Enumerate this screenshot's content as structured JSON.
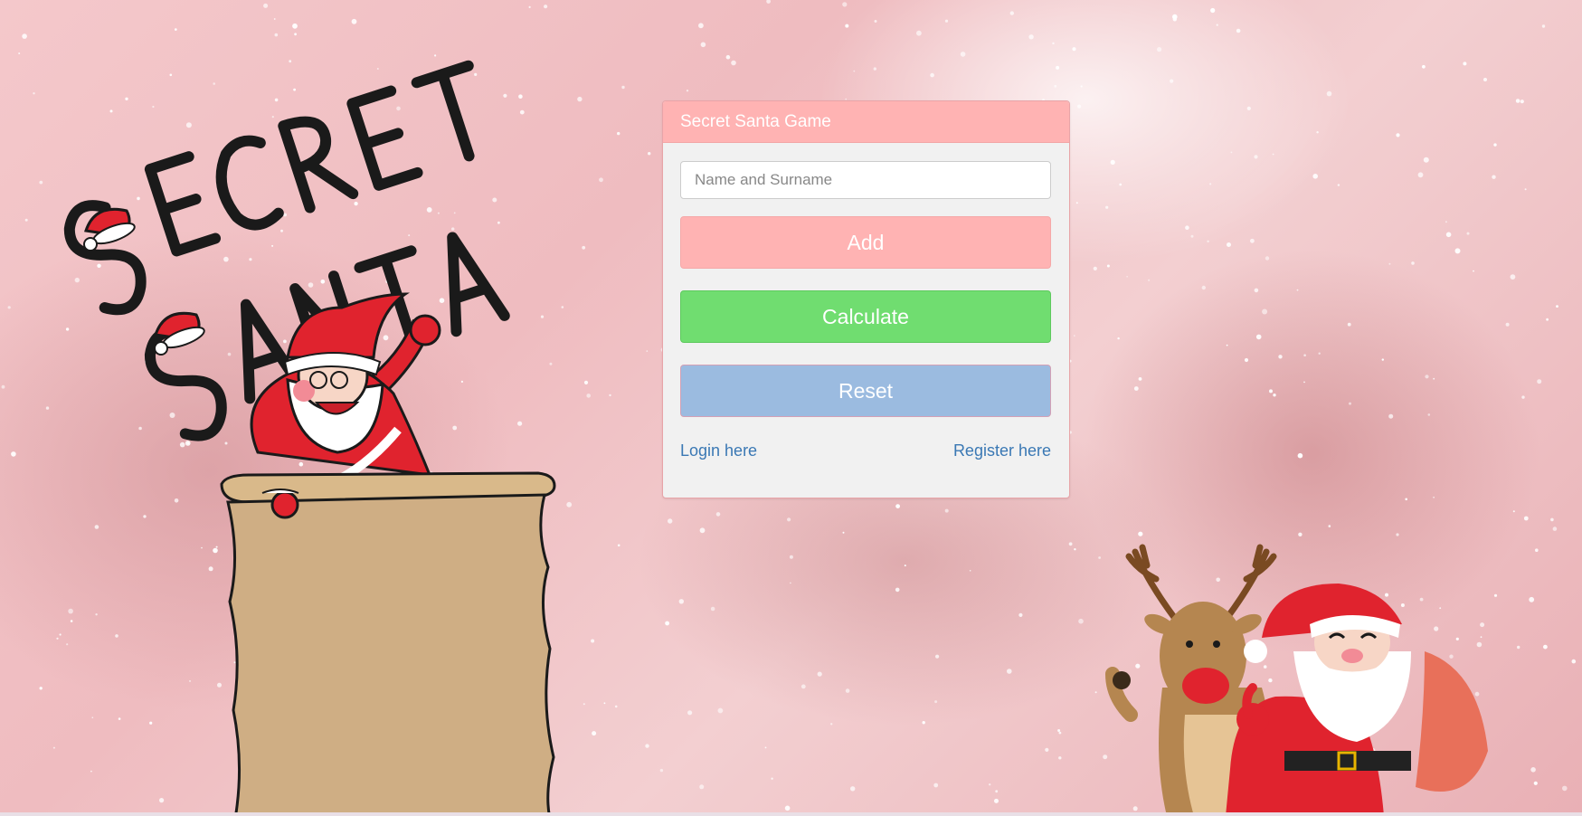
{
  "card": {
    "title": "Secret Santa Game",
    "name_placeholder": "Name and Surname",
    "add_label": "Add",
    "calculate_label": "Calculate",
    "reset_label": "Reset",
    "login_link": "Login here",
    "register_link": "Register here"
  },
  "colors": {
    "header": "#ffb3b3",
    "add_button": "#ffb3b3",
    "calculate_button": "#70dd70",
    "reset_button": "#9bbbe0",
    "link": "#3a78b4"
  },
  "decor": {
    "logo_text": "SECRET SANTA"
  }
}
